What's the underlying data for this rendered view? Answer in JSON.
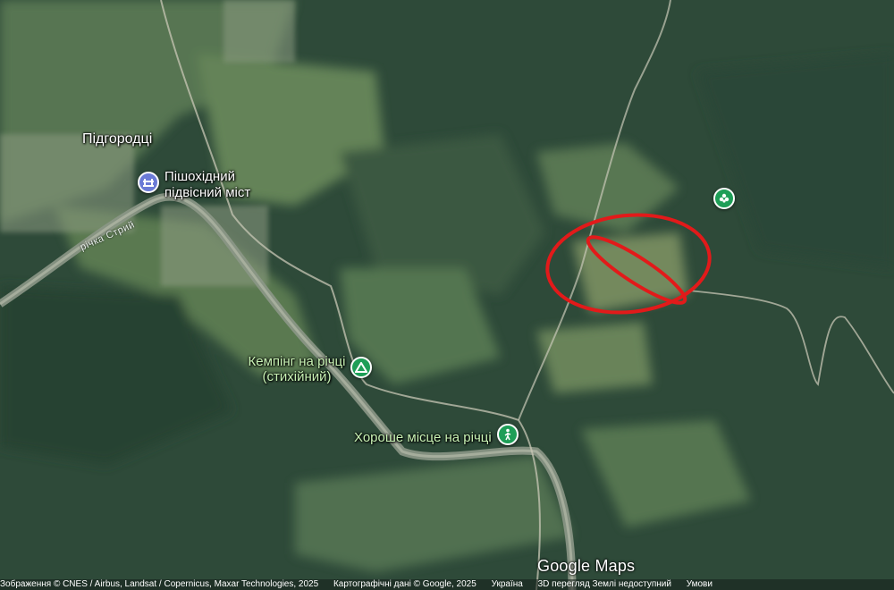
{
  "map": {
    "places": {
      "town": "Підгородці",
      "bridge": "Пішохідний підвісний міст",
      "camping_line1": "Кемпінг на річці",
      "camping_line2": "(стихійний)",
      "good_place": "Хороше місце на річці",
      "river": "річка Стрий"
    },
    "icons": {
      "bridge": "landmark-icon",
      "camping": "campground-icon",
      "good_place": "hiking-icon",
      "poi": "park-icon"
    },
    "colors": {
      "annotation": "#e21a1a",
      "camping_pin": "#1e9e57",
      "poi_pin": "#1e9e57",
      "landmark_pin": "#6b7bd6"
    },
    "logo": "Google Maps",
    "attribution": {
      "imagery": "Зображення © CNES / Airbus, Landsat / Copernicus, Maxar Technologies, 2025",
      "mapdata": "Картографічні дані © Google, 2025",
      "country": "Україна",
      "view": "3D перегляд Землі недоступний",
      "terms": "Умови"
    }
  }
}
